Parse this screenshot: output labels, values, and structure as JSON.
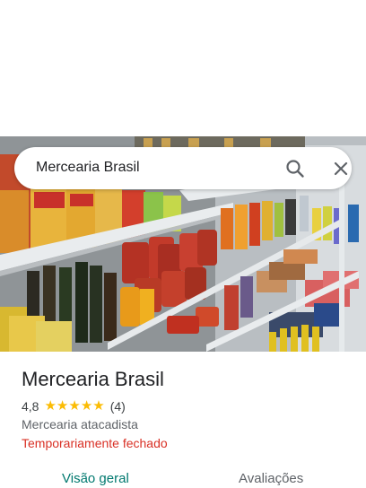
{
  "search": {
    "query": "Mercearia Brasil"
  },
  "place": {
    "name": "Mercearia Brasil",
    "rating": "4,8",
    "stars": 5,
    "review_count": "(4)",
    "category": "Mercearia atacadista",
    "status": "Temporariamente fechado"
  },
  "tabs": [
    {
      "label": "Visão geral",
      "active": true
    },
    {
      "label": "Avaliações",
      "active": false
    }
  ],
  "colors": {
    "star": "#fbbc04",
    "status_closed": "#d93025",
    "tab_active": "#01796f",
    "tab_inactive": "#5f6368"
  },
  "icons": {
    "search": "search-icon",
    "close": "close-icon",
    "star": "star-icon"
  }
}
